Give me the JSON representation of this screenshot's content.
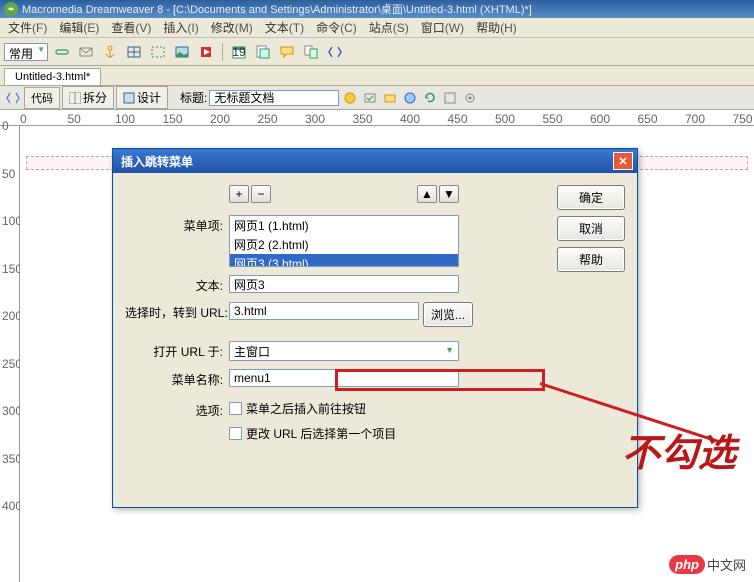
{
  "colors": {
    "accent": "#316ac5",
    "highlight": "#cc2020",
    "danger_text": "#b81818"
  },
  "window": {
    "title": "Macromedia Dreamweaver 8 - [C:\\Documents and Settings\\Administrator\\桌面\\Untitled-3.html (XHTML)*]"
  },
  "menus": [
    {
      "label": "文件",
      "key": "(F)"
    },
    {
      "label": "编辑",
      "key": "(E)"
    },
    {
      "label": "查看",
      "key": "(V)"
    },
    {
      "label": "插入",
      "key": "(I)"
    },
    {
      "label": "修改",
      "key": "(M)"
    },
    {
      "label": "文本",
      "key": "(T)"
    },
    {
      "label": "命令",
      "key": "(C)"
    },
    {
      "label": "站点",
      "key": "(S)"
    },
    {
      "label": "窗口",
      "key": "(W)"
    },
    {
      "label": "帮助",
      "key": "(H)"
    }
  ],
  "insert_toolbar": {
    "category": "常用"
  },
  "tab": {
    "label": "Untitled-3.html*"
  },
  "view": {
    "buttons": {
      "code": "代码",
      "split": "拆分",
      "design": "设计"
    },
    "title_label": "标题:",
    "title_value": "无标题文档"
  },
  "ruler_marks": [
    0,
    50,
    100,
    150,
    200,
    250,
    300,
    350,
    400,
    450,
    500,
    550,
    600,
    650,
    700,
    750
  ],
  "ruler_v_marks": [
    0,
    50,
    100,
    150,
    200,
    250,
    300,
    350,
    400
  ],
  "dialog": {
    "title": "插入跳转菜单",
    "buttons": {
      "ok": "确定",
      "cancel": "取消",
      "help": "帮助"
    },
    "labels": {
      "menu_items": "菜单项:",
      "text": "文本:",
      "on_select": "选择时，转到 URL:",
      "open_in": "打开 URL 于:",
      "menu_name": "菜单名称:",
      "options": "选项:",
      "browse": "浏览..."
    },
    "menu_items": [
      {
        "label": "网页1 (1.html)",
        "selected": false
      },
      {
        "label": "网页2 (2.html)",
        "selected": false
      },
      {
        "label": "网页3 (3.html)",
        "selected": true
      }
    ],
    "text_value": "网页3",
    "url_value": "3.html",
    "open_in_value": "主窗口",
    "menu_name_value": "menu1",
    "checkbox1": "菜单之后插入前往按钮",
    "checkbox2": "更改 URL 后选择第一个项目"
  },
  "annotation": "不勾选",
  "watermark": {
    "badge": "php",
    "text": "中文网"
  }
}
